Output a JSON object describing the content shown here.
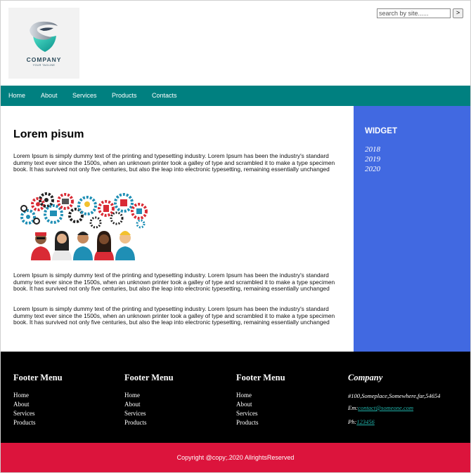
{
  "header": {
    "logo": {
      "name": "COMPANY",
      "tagline": "YOUR TAGLINE"
    },
    "search": {
      "placeholder": "search by site......",
      "button_label": ">"
    }
  },
  "nav": {
    "items": [
      "Home",
      "About",
      "Services",
      "Products",
      "Contacts"
    ]
  },
  "main": {
    "title": "Lorem pisum",
    "paragraphs": [
      "Lorem Ipsum is simply dummy text of the printing and typesetting industry. Lorem Ipsum has been the industry's standard dummy text ever since the 1500s, when an unknown printer took a galley of type and scrambled it to make a type specimen book. It has survived not only five centuries, but also the leap into electronic typesetting, remaining essentially unchanged",
      "Lorem Ipsum is simply dummy text of the printing and typesetting industry. Lorem Ipsum has been the industry's standard dummy text ever since the 1500s, when an unknown printer took a galley of type and scrambled it to make a type specimen book. It has survived not only five centuries, but also the leap into electronic typesetting, remaining essentially unchanged",
      "Lorem Ipsum is simply dummy text of the printing and typesetting industry. Lorem Ipsum has been the industry's standard dummy text ever since the 1500s, when an unknown printer took a galley of type and scrambled it to make a type specimen book. It has survived not only five centuries, but also the leap into electronic typesetting, remaining essentially unchanged"
    ]
  },
  "sidebar": {
    "title": "WIDGET",
    "items": [
      "2018",
      "2019",
      "2020"
    ]
  },
  "footer": {
    "menus": [
      {
        "title": "Footer Menu",
        "links": [
          "Home",
          "About",
          "Services",
          "Products"
        ]
      },
      {
        "title": "Footer Menu",
        "links": [
          "Home",
          "About",
          "Services",
          "Products"
        ]
      },
      {
        "title": "Footer Menu",
        "links": [
          "Home",
          "About",
          "Services",
          "Products"
        ]
      }
    ],
    "company": {
      "title": "Company",
      "address": "#100,Someplace,Somewhere,far,54654",
      "email_label": "Em:",
      "email": "contact@someone.com",
      "phone_label": "Ph:",
      "phone": "123456"
    },
    "copyright": "Copyright @copy;.2020 AllrightsReserved"
  },
  "colors": {
    "nav_bg": "#008080",
    "sidebar_bg": "#4169e1",
    "footer_bg": "#000000",
    "copyright_bg": "#dc143c",
    "link": "#20b2aa"
  }
}
